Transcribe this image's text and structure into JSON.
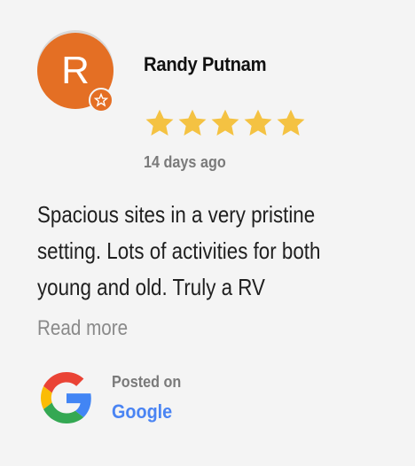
{
  "review": {
    "avatar_letter": "R",
    "avatar_color": "#e46f24",
    "reviewer_name": "Randy Putnam",
    "rating": 5,
    "rating_max": 5,
    "star_color": "#f4c242",
    "date": "14 days ago",
    "text": "Spacious sites in a very pristine setting. Lots of activities for both young and old. Truly a RV",
    "read_more": "Read more"
  },
  "source": {
    "posted_on": "Posted on",
    "platform": "Google",
    "platform_color": "#4a84f3",
    "icon": "google-icon"
  }
}
